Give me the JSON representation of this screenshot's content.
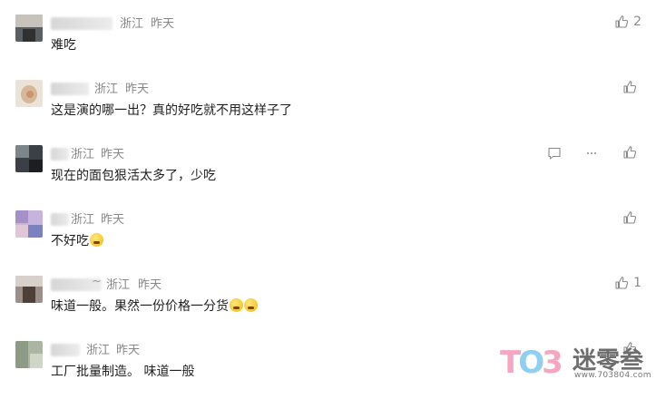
{
  "comments": [
    {
      "region": "浙江",
      "time": "昨天",
      "text": "难吃",
      "likes": "2",
      "name_suffix": "",
      "emoji_count": 0
    },
    {
      "region": "浙江",
      "time": "昨天",
      "text": "这是演的哪一出？真的好吃就不用这样子了",
      "likes": "",
      "name_suffix": "",
      "emoji_count": 0
    },
    {
      "region": "浙江",
      "time": "昨天",
      "text": "现在的面包狠活太多了，少吃",
      "likes": "",
      "name_suffix": "",
      "emoji_count": 0
    },
    {
      "region": "浙江",
      "time": "昨天",
      "text": "不好吃",
      "likes": "",
      "name_suffix": "",
      "emoji_count": 1
    },
    {
      "region": "浙江",
      "time": "昨天",
      "text": "味道一般。果然一份价格一分货",
      "likes": "1",
      "name_suffix": "~",
      "emoji_count": 2
    },
    {
      "region": "浙江",
      "time": "昨天",
      "text": "工厂批量制造。 味道一般",
      "likes": "",
      "name_suffix": "",
      "emoji_count": 0
    }
  ],
  "icons": {
    "like": "thumbs-up-icon",
    "reply": "comment-bubble-icon",
    "share": "share-icon",
    "emoji": "emoji-icon"
  },
  "watermark": {
    "logo": "TO3",
    "brand": "迷零叁",
    "url": "www.703804.com"
  }
}
